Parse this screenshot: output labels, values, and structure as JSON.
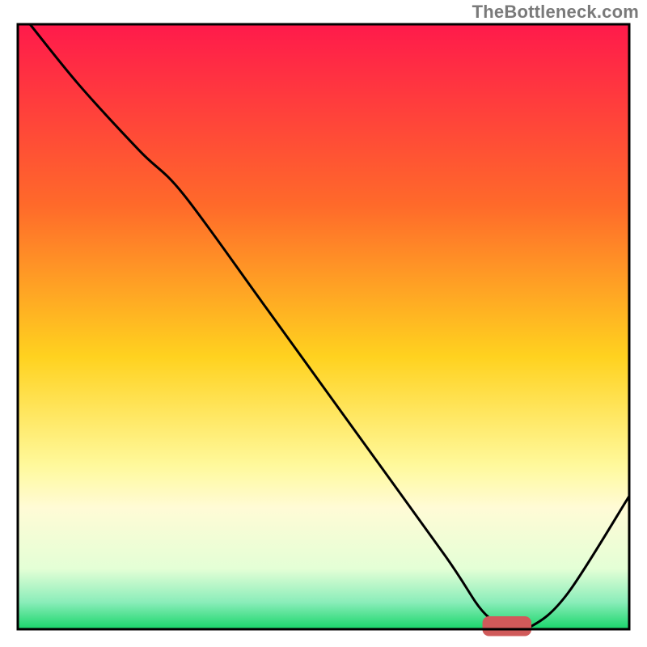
{
  "attribution": "TheBottleneck.com",
  "chart_data": {
    "type": "line",
    "title": "",
    "xlabel": "",
    "ylabel": "",
    "xlim": [
      0,
      100
    ],
    "ylim": [
      0,
      100
    ],
    "grid": false,
    "legend": false,
    "gradient_stops": [
      {
        "offset": 0.0,
        "color": "#ff1a4b"
      },
      {
        "offset": 0.3,
        "color": "#ff6a2a"
      },
      {
        "offset": 0.55,
        "color": "#ffd21f"
      },
      {
        "offset": 0.73,
        "color": "#fff99c"
      },
      {
        "offset": 0.8,
        "color": "#fffbd6"
      },
      {
        "offset": 0.9,
        "color": "#e4ffd6"
      },
      {
        "offset": 0.955,
        "color": "#8bedba"
      },
      {
        "offset": 1.0,
        "color": "#18d66a"
      }
    ],
    "series": [
      {
        "name": "bottleneck-curve",
        "type": "line",
        "color": "#000000",
        "x": [
          2,
          10,
          20,
          27,
          40,
          55,
          70,
          76,
          80,
          84,
          90,
          100
        ],
        "y": [
          100,
          90,
          79,
          72,
          54,
          33,
          12,
          3,
          0.5,
          0.5,
          6,
          22
        ]
      }
    ],
    "marker": {
      "name": "optimal-range",
      "color": "#d05a5a",
      "x_start": 76,
      "x_end": 84,
      "y": 0.5,
      "thickness": 2.2
    },
    "axes": {
      "show_ticks": false,
      "show_labels": false,
      "frame_color": "#000000",
      "frame_width": 3
    }
  }
}
